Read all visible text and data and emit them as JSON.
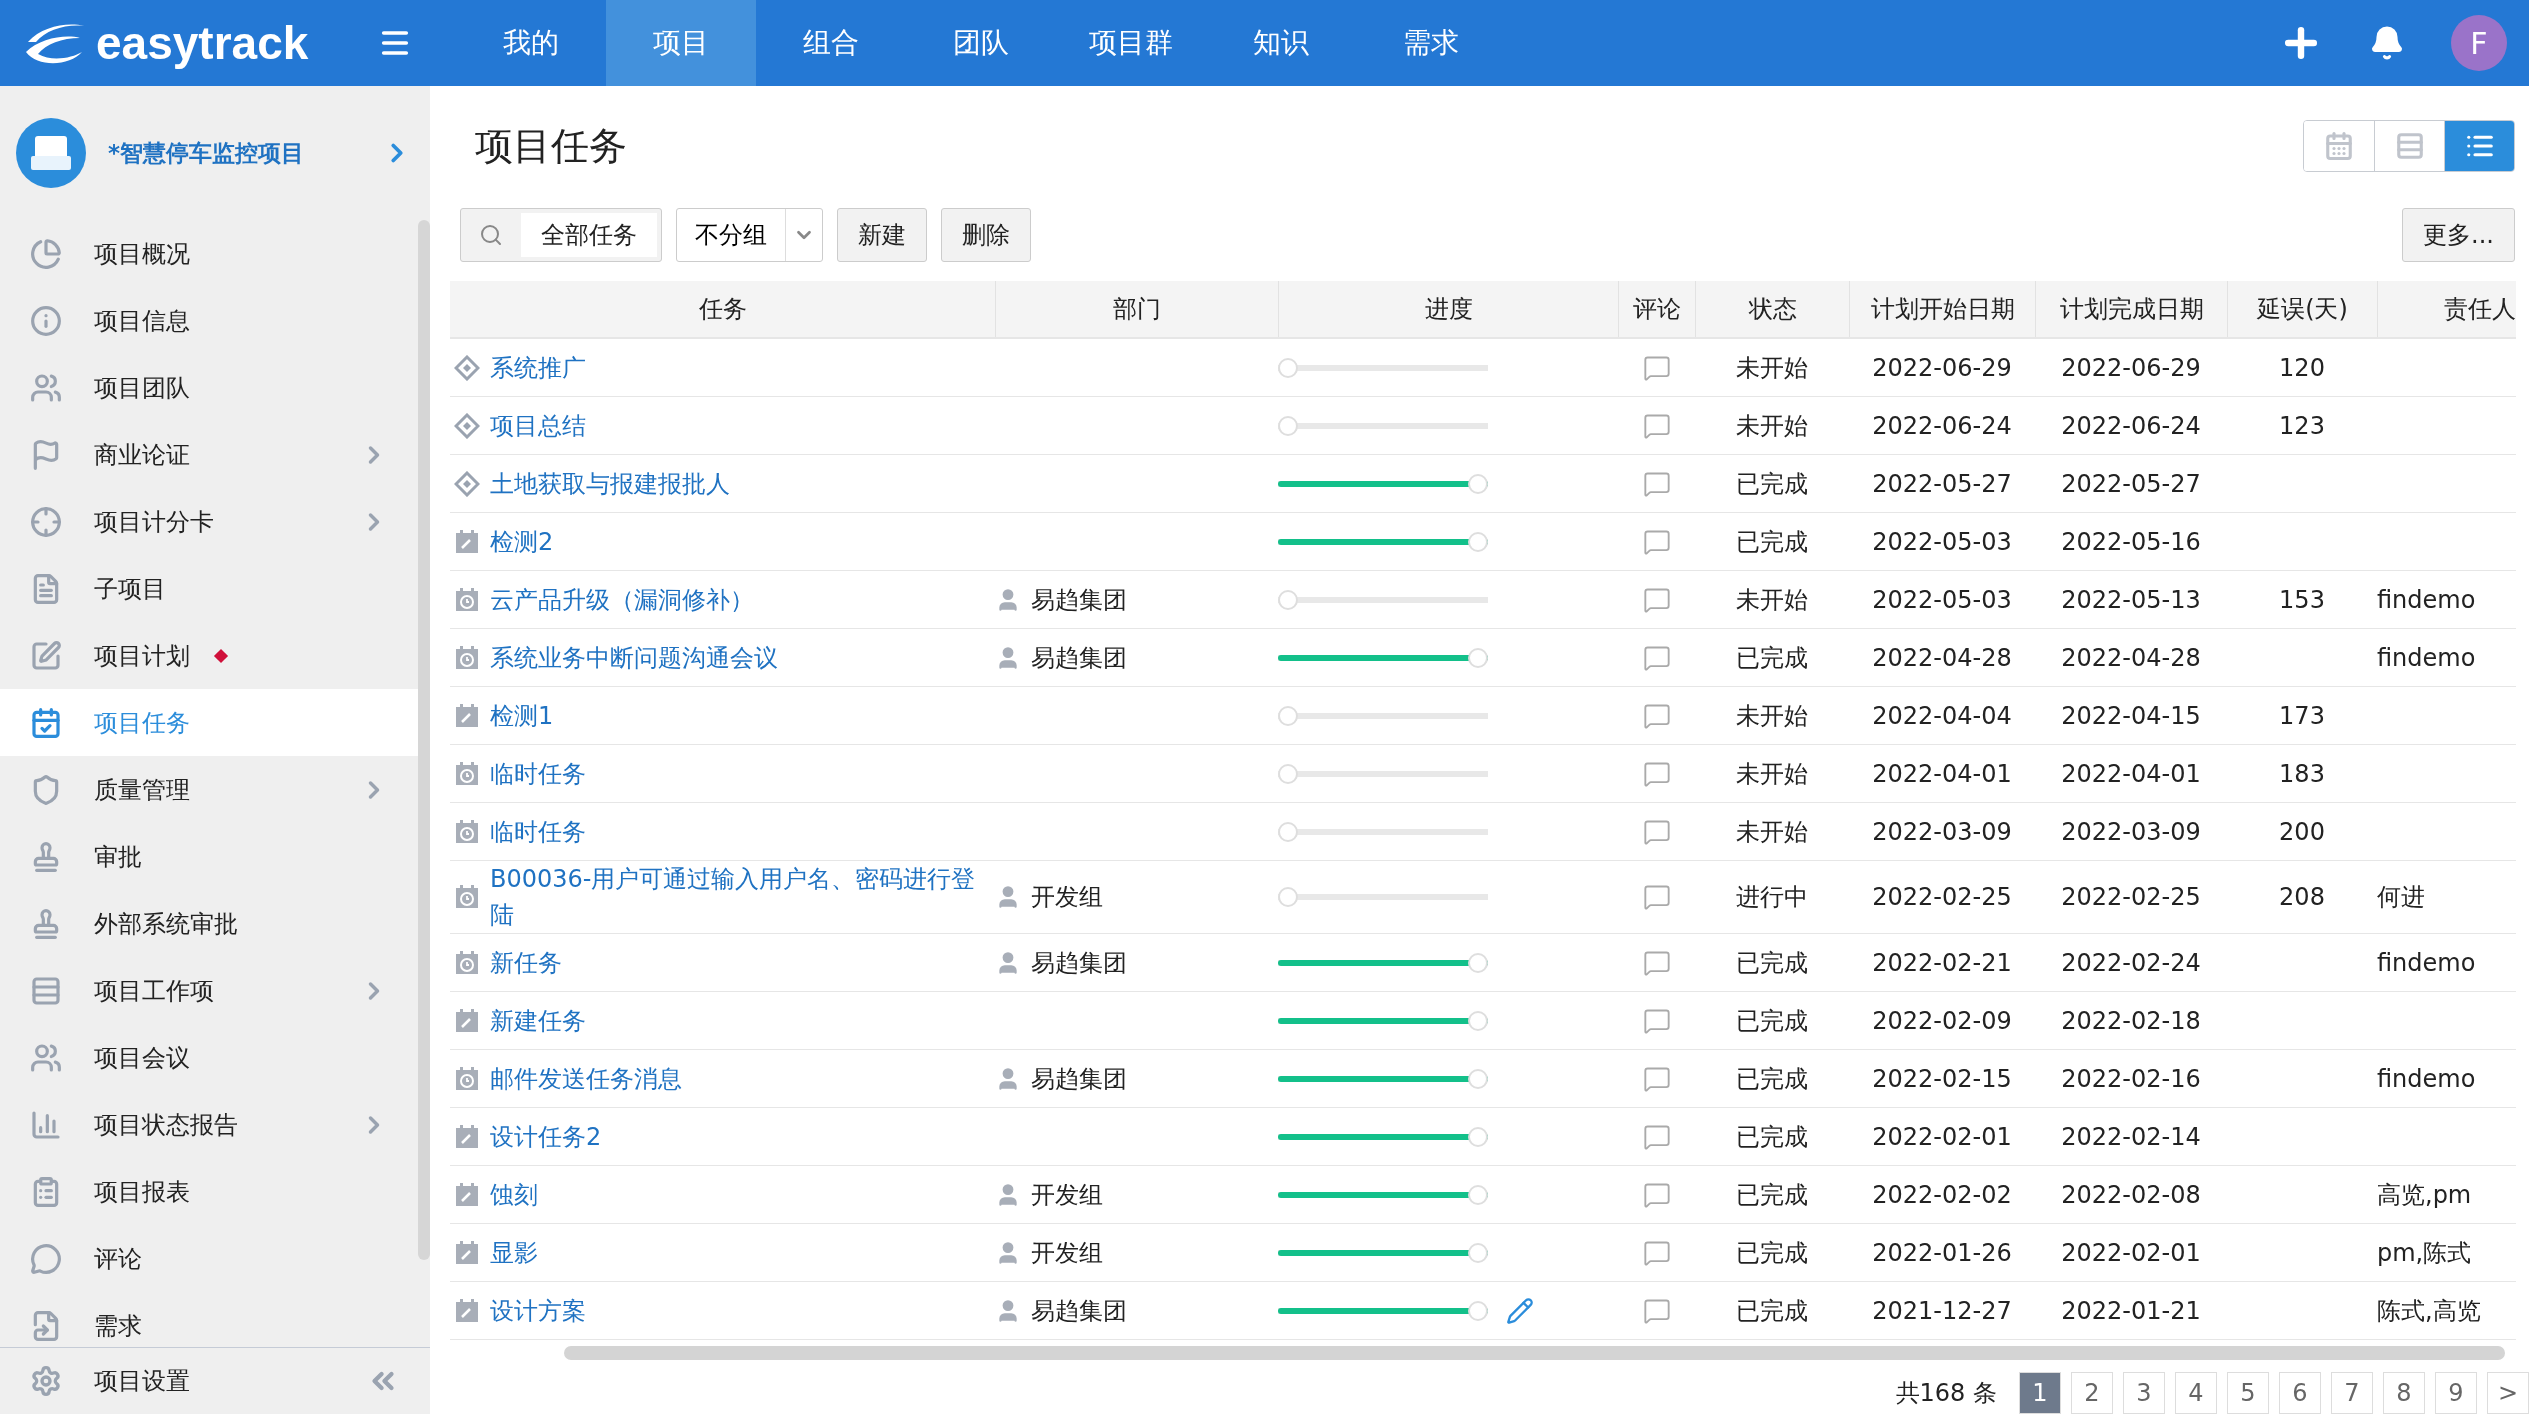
{
  "brand": "easytrack",
  "nav": [
    {
      "label": "我的",
      "selected": false
    },
    {
      "label": "项目",
      "selected": true
    },
    {
      "label": "组合",
      "selected": false
    },
    {
      "label": "团队",
      "selected": false
    },
    {
      "label": "项目群",
      "selected": false
    },
    {
      "label": "知识",
      "selected": false
    },
    {
      "label": "需求",
      "selected": false
    }
  ],
  "user": {
    "initial": "F"
  },
  "project": {
    "name": "*智慧停车监控项目"
  },
  "sidebar": {
    "items": [
      {
        "label": "项目概况",
        "selected": false,
        "submenu": false,
        "badge": false
      },
      {
        "label": "项目信息",
        "selected": false,
        "submenu": false,
        "badge": false
      },
      {
        "label": "项目团队",
        "selected": false,
        "submenu": false,
        "badge": false
      },
      {
        "label": "商业论证",
        "selected": false,
        "submenu": true,
        "badge": false
      },
      {
        "label": "项目计分卡",
        "selected": false,
        "submenu": true,
        "badge": false
      },
      {
        "label": "子项目",
        "selected": false,
        "submenu": false,
        "badge": false
      },
      {
        "label": "项目计划",
        "selected": false,
        "submenu": false,
        "badge": true
      },
      {
        "label": "项目任务",
        "selected": true,
        "submenu": false,
        "badge": false
      },
      {
        "label": "质量管理",
        "selected": false,
        "submenu": true,
        "badge": false
      },
      {
        "label": "审批",
        "selected": false,
        "submenu": false,
        "badge": false
      },
      {
        "label": "外部系统审批",
        "selected": false,
        "submenu": false,
        "badge": false
      },
      {
        "label": "项目工作项",
        "selected": false,
        "submenu": true,
        "badge": false
      },
      {
        "label": "项目会议",
        "selected": false,
        "submenu": false,
        "badge": false
      },
      {
        "label": "项目状态报告",
        "selected": false,
        "submenu": true,
        "badge": false
      },
      {
        "label": "项目报表",
        "selected": false,
        "submenu": false,
        "badge": false
      },
      {
        "label": "评论",
        "selected": false,
        "submenu": false,
        "badge": false
      },
      {
        "label": "需求",
        "selected": false,
        "submenu": false,
        "badge": false
      }
    ],
    "footer": "项目设置"
  },
  "page_title": "项目任务",
  "views": [
    {
      "kind": "calendar",
      "selected": false
    },
    {
      "kind": "rows",
      "selected": false
    },
    {
      "kind": "list",
      "selected": true
    }
  ],
  "toolbar": {
    "filter": "全部任务",
    "group": "不分组",
    "buttons": [
      "新建",
      "删除"
    ],
    "more": "更多..."
  },
  "table": {
    "columns": [
      "任务",
      "部门",
      "进度",
      "评论",
      "状态",
      "计划开始日期",
      "计划完成日期",
      "延误(天)",
      "责任人"
    ],
    "rows": [
      {
        "kind": "milestone",
        "task": "系统推广",
        "dept": "",
        "level": 0,
        "status": "未开始",
        "start": "2022-06-29",
        "end": "2022-06-29",
        "delay": "120",
        "owner": "",
        "hovered": false
      },
      {
        "kind": "milestone",
        "task": "项目总结",
        "dept": "",
        "level": 0,
        "status": "未开始",
        "start": "2022-06-24",
        "end": "2022-06-24",
        "delay": "123",
        "owner": "",
        "hovered": false
      },
      {
        "kind": "milestone",
        "task": "土地获取与报建报批人",
        "dept": "",
        "level": 1,
        "status": "已完成",
        "start": "2022-05-27",
        "end": "2022-05-27",
        "delay": "",
        "owner": "",
        "hovered": false
      },
      {
        "kind": "task",
        "task": "检测2",
        "dept": "",
        "level": 1,
        "status": "已完成",
        "start": "2022-05-03",
        "end": "2022-05-16",
        "delay": "",
        "owner": "",
        "hovered": false
      },
      {
        "kind": "meeting",
        "task": "云产品升级（漏洞修补）",
        "dept": "易趋集团",
        "level": 0,
        "status": "未开始",
        "start": "2022-05-03",
        "end": "2022-05-13",
        "delay": "153",
        "owner": "findemo",
        "hovered": false
      },
      {
        "kind": "meeting",
        "task": "系统业务中断问题沟通会议",
        "dept": "易趋集团",
        "level": 1,
        "status": "已完成",
        "start": "2022-04-28",
        "end": "2022-04-28",
        "delay": "",
        "owner": "findemo",
        "hovered": false
      },
      {
        "kind": "task",
        "task": "检测1",
        "dept": "",
        "level": 0,
        "status": "未开始",
        "start": "2022-04-04",
        "end": "2022-04-15",
        "delay": "173",
        "owner": "",
        "hovered": false
      },
      {
        "kind": "meeting",
        "task": "临时任务",
        "dept": "",
        "level": 0,
        "status": "未开始",
        "start": "2022-04-01",
        "end": "2022-04-01",
        "delay": "183",
        "owner": "",
        "hovered": false
      },
      {
        "kind": "meeting",
        "task": "临时任务",
        "dept": "",
        "level": 0,
        "status": "未开始",
        "start": "2022-03-09",
        "end": "2022-03-09",
        "delay": "200",
        "owner": "",
        "hovered": false
      },
      {
        "kind": "meeting",
        "task": "B00036-用户可通过输入用户名、密码进行登陆",
        "dept": "开发组",
        "level": 0,
        "status": "进行中",
        "start": "2022-02-25",
        "end": "2022-02-25",
        "delay": "208",
        "owner": "何进",
        "hovered": false
      },
      {
        "kind": "meeting",
        "task": "新任务",
        "dept": "易趋集团",
        "level": 1,
        "status": "已完成",
        "start": "2022-02-21",
        "end": "2022-02-24",
        "delay": "",
        "owner": "findemo",
        "hovered": false
      },
      {
        "kind": "task",
        "task": "新建任务",
        "dept": "",
        "level": 1,
        "status": "已完成",
        "start": "2022-02-09",
        "end": "2022-02-18",
        "delay": "",
        "owner": "",
        "hovered": false
      },
      {
        "kind": "meeting",
        "task": "邮件发送任务消息",
        "dept": "易趋集团",
        "level": 1,
        "status": "已完成",
        "start": "2022-02-15",
        "end": "2022-02-16",
        "delay": "",
        "owner": "findemo",
        "hovered": false
      },
      {
        "kind": "task",
        "task": "设计任务2",
        "dept": "",
        "level": 1,
        "status": "已完成",
        "start": "2022-02-01",
        "end": "2022-02-14",
        "delay": "",
        "owner": "",
        "hovered": false
      },
      {
        "kind": "task",
        "task": "蚀刻",
        "dept": "开发组",
        "level": 1,
        "status": "已完成",
        "start": "2022-02-02",
        "end": "2022-02-08",
        "delay": "",
        "owner": "高览,pm",
        "hovered": false
      },
      {
        "kind": "task",
        "task": "显影",
        "dept": "开发组",
        "level": 1,
        "status": "已完成",
        "start": "2022-01-26",
        "end": "2022-02-01",
        "delay": "",
        "owner": "pm,陈式",
        "hovered": false
      },
      {
        "kind": "task",
        "task": "设计方案",
        "dept": "易趋集团",
        "level": 1,
        "status": "已完成",
        "start": "2021-12-27",
        "end": "2022-01-21",
        "delay": "",
        "owner": "陈式,高览",
        "hovered": true
      }
    ]
  },
  "pagination": {
    "total": "共168 条",
    "pages": [
      {
        "label": "1",
        "selected": true
      },
      {
        "label": "2",
        "selected": false
      },
      {
        "label": "3",
        "selected": false
      },
      {
        "label": "4",
        "selected": false
      },
      {
        "label": "5",
        "selected": false
      },
      {
        "label": "6",
        "selected": false
      },
      {
        "label": "7",
        "selected": false
      },
      {
        "label": "8",
        "selected": false
      },
      {
        "label": "9",
        "selected": false
      }
    ],
    "next": ">"
  }
}
